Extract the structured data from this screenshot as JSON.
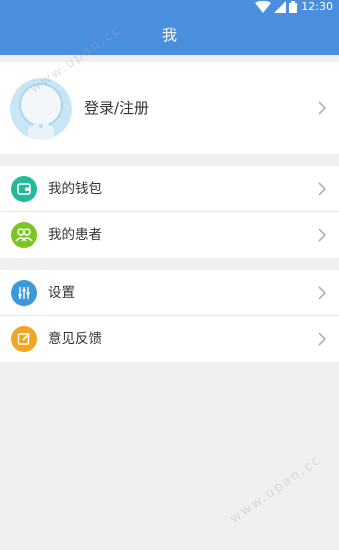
{
  "status_bar": {
    "time": "12:30",
    "icons": [
      "wifi-icon",
      "signal-icon",
      "battery-icon"
    ]
  },
  "header": {
    "title": "我"
  },
  "profile": {
    "login_label": "登录/注册",
    "avatar_icon": "avatar-placeholder-icon"
  },
  "menu_groups": [
    {
      "items": [
        {
          "label": "我的钱包",
          "icon": "wallet-icon",
          "icon_color": "#23b99a"
        },
        {
          "label": "我的患者",
          "icon": "patients-icon",
          "icon_color": "#7cc623"
        }
      ]
    },
    {
      "items": [
        {
          "label": "设置",
          "icon": "settings-sliders-icon",
          "icon_color": "#3a9ad9"
        },
        {
          "label": "意见反馈",
          "icon": "feedback-edit-icon",
          "icon_color": "#f0a623"
        }
      ]
    }
  ],
  "watermark": "www.upan.cc",
  "colors": {
    "accent": "#4a8fde",
    "background": "#f0f0f0",
    "chevron": "#b3b3b3"
  }
}
